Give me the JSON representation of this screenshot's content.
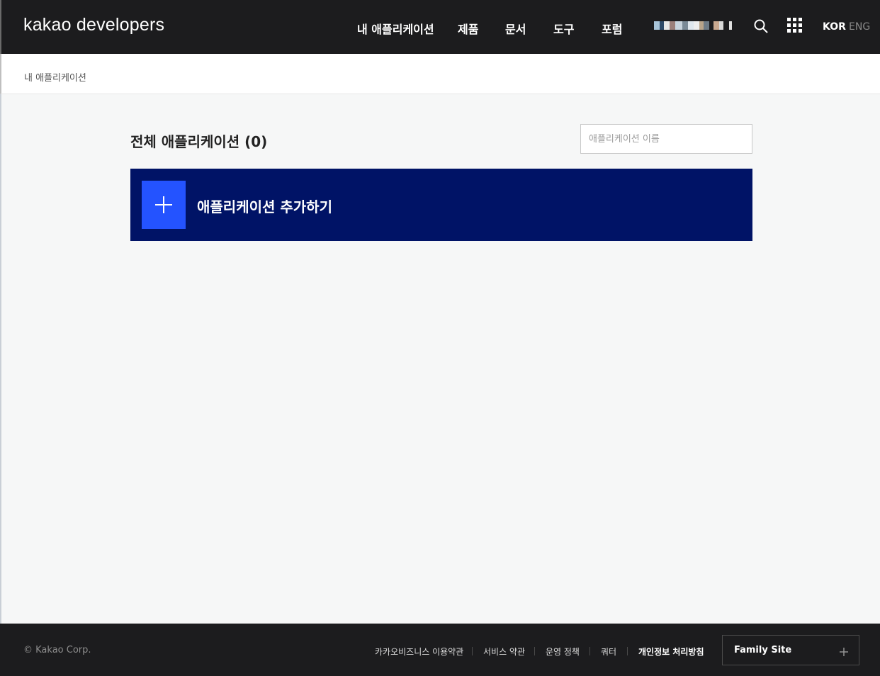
{
  "header": {
    "logo_bold": "kakao",
    "logo_light": "developers",
    "nav": [
      {
        "label": "내 애플리케이션"
      },
      {
        "label": "제품"
      },
      {
        "label": "문서"
      },
      {
        "label": "도구"
      },
      {
        "label": "포럼"
      }
    ],
    "icons": {
      "search": "search-icon",
      "apps": "grid-icon"
    },
    "lang_kor": "KOR",
    "lang_eng": "ENG"
  },
  "breadcrumb": {
    "current": "내 애플리케이션"
  },
  "main": {
    "title": "전체 애플리케이션 (0)",
    "search_placeholder": "애플리케이션 이름",
    "add_app_label": "애플리케이션 추가하기"
  },
  "footer": {
    "copyright": "© Kakao Corp.",
    "links": [
      {
        "label": "카카오비즈니스 이용약관"
      },
      {
        "label": "서비스 약관"
      },
      {
        "label": "운영 정책"
      },
      {
        "label": "쿼터"
      },
      {
        "label": "개인정보 처리방침"
      }
    ],
    "family_site": "Family Site"
  },
  "colors": {
    "header_bg": "#1c1c1e",
    "accent_navy": "#001366",
    "accent_blue": "#2453ff",
    "page_bg": "#f6f7f7"
  }
}
